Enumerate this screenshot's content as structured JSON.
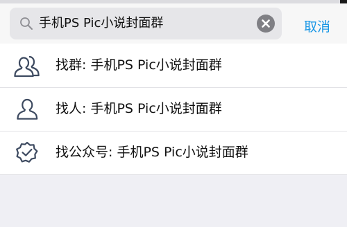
{
  "search": {
    "query": "手机PS Pic小说封面群",
    "cancel_label": "取消"
  },
  "results": [
    {
      "icon": "group-icon",
      "label": "找群: 手机PS Pic小说封面群"
    },
    {
      "icon": "person-icon",
      "label": "找人: 手机PS Pic小说封面群"
    },
    {
      "icon": "verified-badge-icon",
      "label": "找公众号: 手机PS Pic小说封面群"
    }
  ]
}
